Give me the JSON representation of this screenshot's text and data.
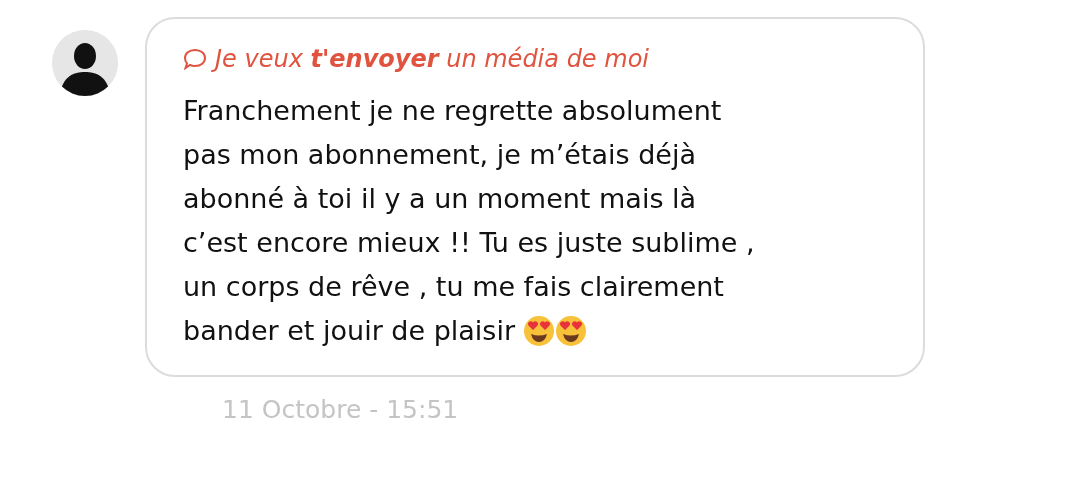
{
  "message": {
    "quote": "Je veux **t'envoyer** un média de moi",
    "body_lines": [
      "Franchement je ne regrette absolument",
      "pas mon abonnement, je m’étais déjà",
      "abonné à toi il y a un moment mais là",
      "c’est encore mieux !! Tu es juste sublime ,",
      "un corps de rêve , tu me fais clairement",
      "bander et jouir de plaisir"
    ],
    "emojis": [
      {
        "kind": "heart-eyes"
      },
      {
        "kind": "heart-eyes"
      }
    ],
    "timestamp": "11 Octobre - 15:51"
  }
}
